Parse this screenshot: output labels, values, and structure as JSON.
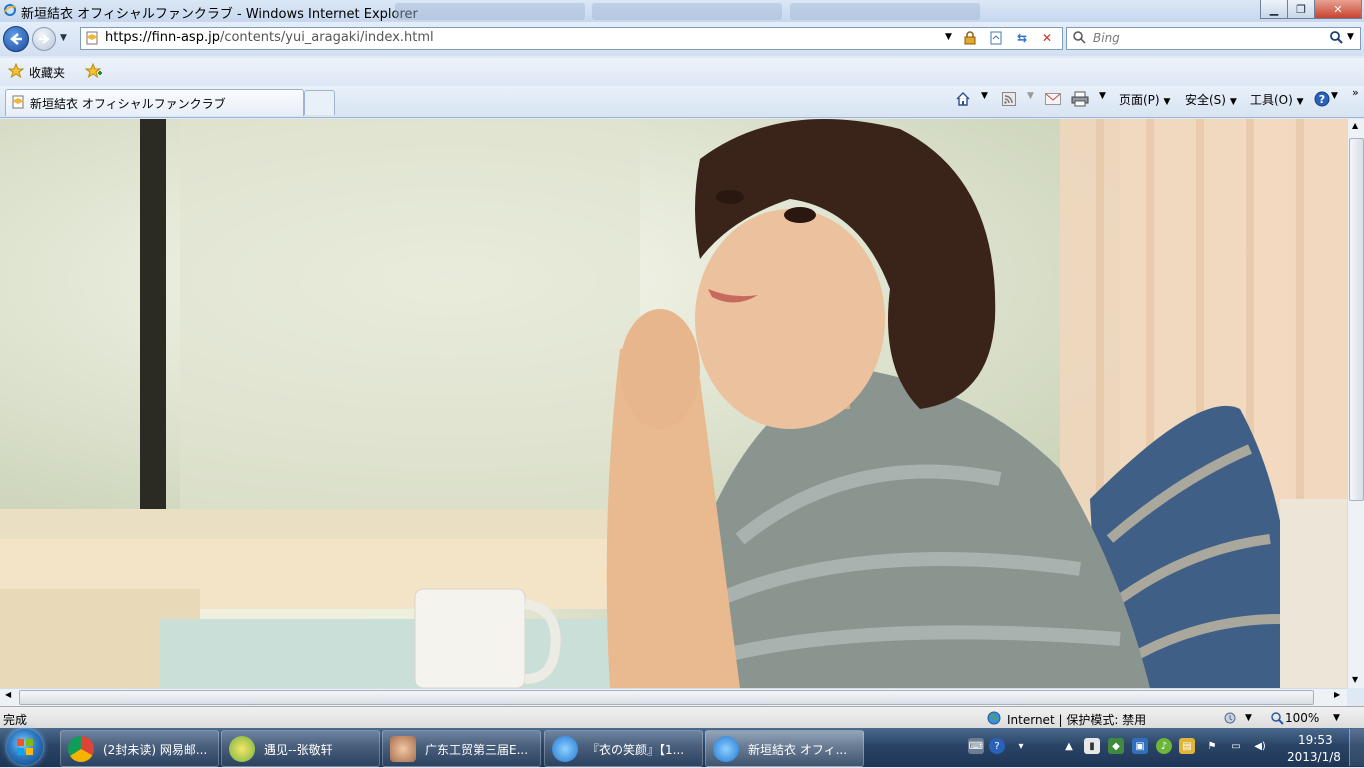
{
  "window": {
    "title": "新垣結衣 オフィシャルファンクラブ - Windows Internet Explorer",
    "controls": [
      "minimize",
      "maximize",
      "close"
    ]
  },
  "address_bar": {
    "url_host": "https://finn-asp.jp",
    "url_path": "/contents/yui_aragaki/index.html",
    "icons": [
      "page-icon",
      "lock-icon",
      "compatibility-icon",
      "refresh-icon",
      "stop-icon"
    ]
  },
  "search": {
    "placeholder": "Bing"
  },
  "favorites_bar": {
    "label": "收藏夹"
  },
  "tabs": [
    {
      "label": "新垣結衣 オフィシャルファンクラブ"
    }
  ],
  "command_bar": {
    "page": "页面(P)",
    "safety": "安全(S)",
    "tools": "工具(O)",
    "icons": [
      "home-icon",
      "feeds-icon",
      "mail-icon",
      "print-icon",
      "help-icon"
    ]
  },
  "content": {
    "description_icon": "photo"
  },
  "status_bar": {
    "status": "完成",
    "zone": "Internet | 保护模式: 禁用",
    "zoom": "100%"
  },
  "taskbar": {
    "items": [
      {
        "label": "(2封未读) 网易邮...",
        "icon": "chrome-icon"
      },
      {
        "label": "遇见--张敬轩",
        "icon": "music-player-icon"
      },
      {
        "label": "广东工贸第三届E...",
        "icon": "chat-icon"
      },
      {
        "label": "『衣の笑颜』【1...",
        "icon": "ie-icon"
      },
      {
        "label": "新垣結衣 オフィ...",
        "icon": "ie-icon"
      }
    ],
    "clock": {
      "time": "19:53",
      "date": "2013/1/8"
    }
  },
  "colors": {
    "chrome_blue": "#dfe9f5",
    "taskbar": "#2a4466",
    "close_button": "#c7432d"
  }
}
